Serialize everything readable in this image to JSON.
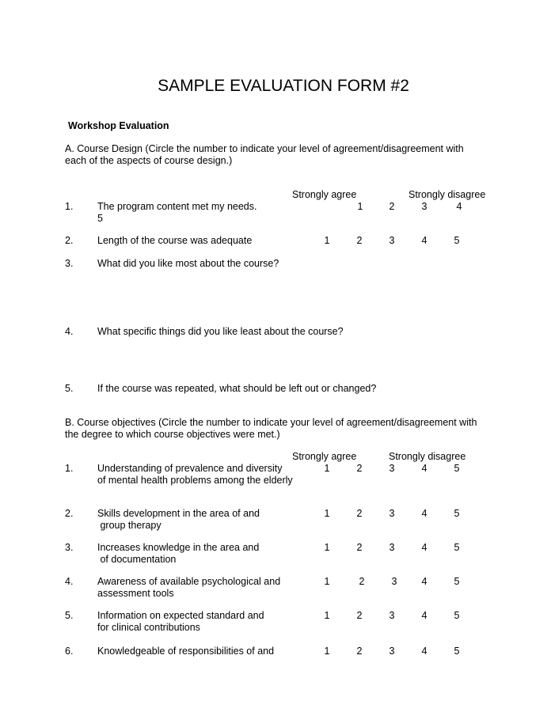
{
  "title": "SAMPLE EVALUATION FORM #2",
  "subtitle": "Workshop Evaluation",
  "sectionA": {
    "intro_line1": "A. Course Design (Circle the number to indicate your level of agreement/disagreement with",
    "intro_line2": "each of the aspects of course design.)",
    "scale_left": "Strongly agree",
    "scale_right": "Strongly disagree",
    "items": [
      {
        "num": "1.",
        "text": "The program content met my needs.",
        "wrap": "5",
        "scale": [
          "1",
          "2",
          "3",
          "4"
        ]
      },
      {
        "num": "2.",
        "text": "Length of the course was adequate",
        "scale": [
          "1",
          "2",
          "3",
          "4",
          "5"
        ]
      },
      {
        "num": "3.",
        "text": "What did you like most about the course?"
      },
      {
        "num": "4.",
        "text": "What specific things did you like least about the course?"
      },
      {
        "num": "5.",
        "text": "If the course was repeated, what should be left out or changed?"
      }
    ]
  },
  "sectionB": {
    "intro_line1": "B. Course objectives (Circle the number to indicate your level of agreement/disagreement with",
    "intro_line2": "the degree to which course objectives were met.)",
    "scale_left": "Strongly agree",
    "scale_right": "Strongly disagree",
    "items": [
      {
        "num": "1.",
        "line1": "Understanding of prevalence and diversity",
        "line2": "of mental health problems among the elderly",
        "scale": [
          "1",
          "2",
          "3",
          "4",
          "5"
        ]
      },
      {
        "num": "2.",
        "line1": "Skills development in the area of and",
        "line2": " group therapy",
        "scale": [
          "1",
          "2",
          "3",
          "4",
          "5"
        ]
      },
      {
        "num": "3.",
        "line1": "Increases knowledge in the area and",
        "line2": " of documentation",
        "scale": [
          "1",
          "2",
          "3",
          "4",
          "5"
        ]
      },
      {
        "num": "4.",
        "line1": "Awareness of available psychological and",
        "line2": "assessment tools",
        "scale": [
          "1",
          "2",
          "3",
          "4",
          "5"
        ]
      },
      {
        "num": "5.",
        "line1": "Information on expected standard and",
        "line2": "for clinical contributions",
        "scale": [
          "1",
          "2",
          "3",
          "4",
          "5"
        ]
      },
      {
        "num": "6.",
        "line1": "Knowledgeable of responsibilities of and",
        "scale": [
          "1",
          "2",
          "3",
          "4",
          "5"
        ]
      }
    ]
  }
}
